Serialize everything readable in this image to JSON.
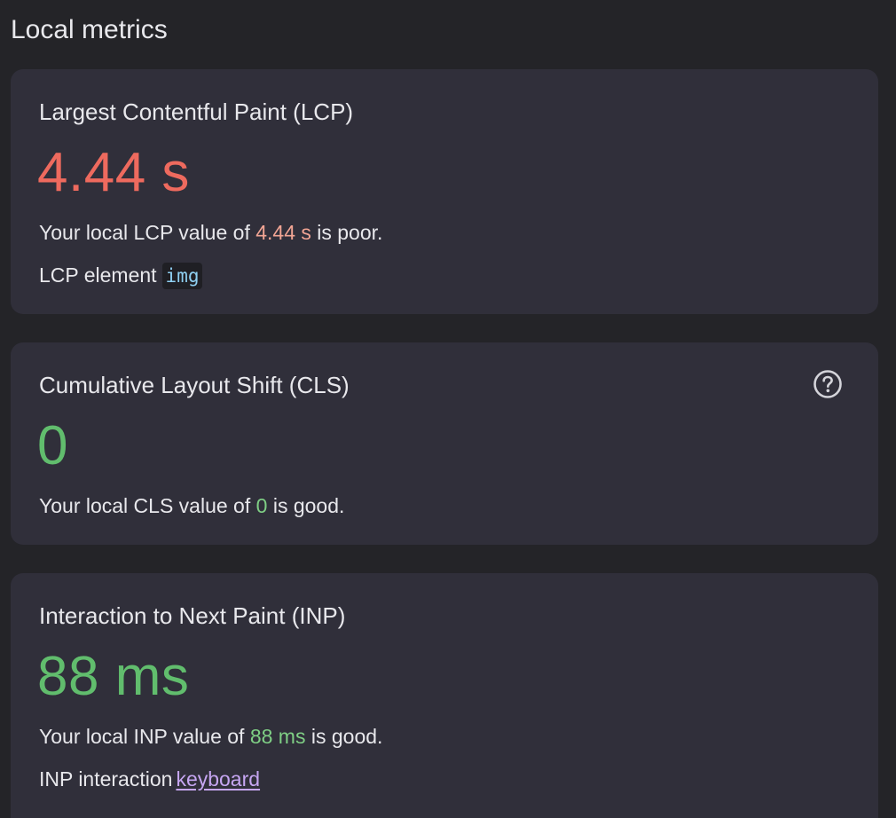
{
  "section": {
    "title": "Local metrics"
  },
  "colors": {
    "background": "#242428",
    "card": "#302f3a",
    "poor": "#ee6a5e",
    "good": "#61bd6d",
    "link": "#c6a6f2",
    "element_chip_text": "#8fd0f2"
  },
  "lcp": {
    "title": "Largest Contentful Paint (LCP)",
    "value": "4.44 s",
    "status": "poor",
    "desc_prefix": "Your local LCP value of ",
    "desc_value": "4.44 s",
    "desc_suffix": " is poor.",
    "element_label": "LCP element",
    "element_value": "img"
  },
  "cls": {
    "title": "Cumulative Layout Shift (CLS)",
    "value": "0",
    "status": "good",
    "desc_prefix": "Your local CLS value of ",
    "desc_value": "0",
    "desc_suffix": " is good.",
    "help_icon": "question-circle-icon"
  },
  "inp": {
    "title": "Interaction to Next Paint (INP)",
    "value": "88 ms",
    "status": "good",
    "desc_prefix": "Your local INP value of ",
    "desc_value": "88 ms",
    "desc_suffix": " is good.",
    "interaction_label": "INP interaction",
    "interaction_value": "keyboard"
  }
}
